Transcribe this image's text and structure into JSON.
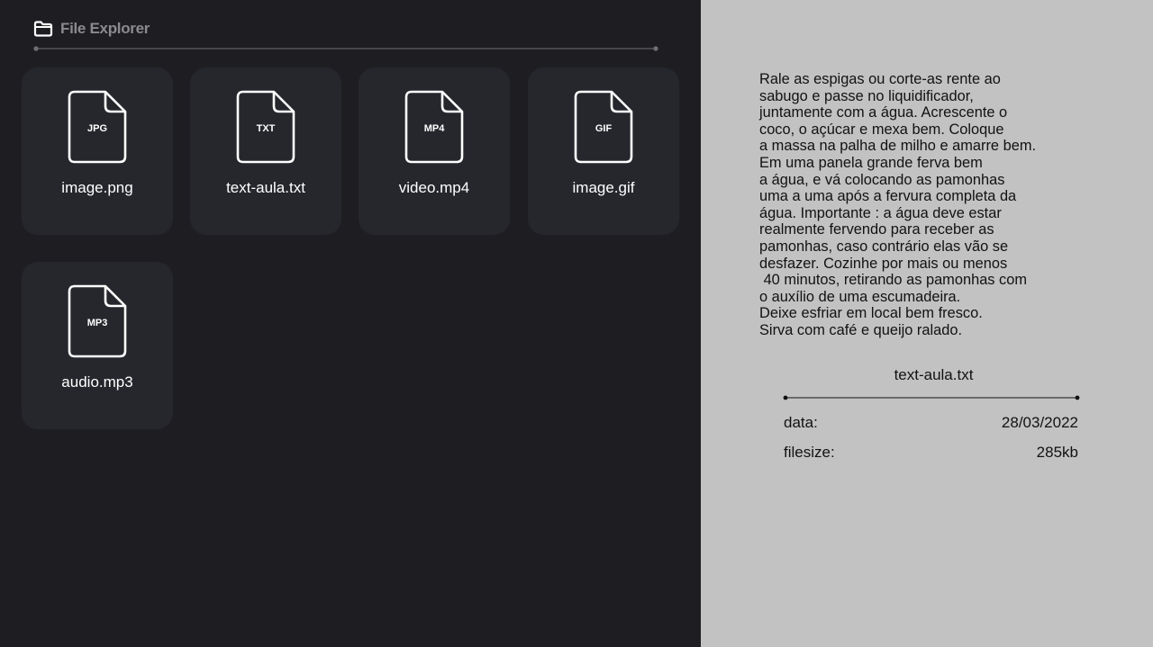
{
  "app": {
    "title": "File Explorer",
    "icon": "folder-icon"
  },
  "colors": {
    "panel_bg": "#1e1e22",
    "card_bg": "#26272d",
    "preview_bg": "#c2c2c2",
    "title_text": "#8b8b8f",
    "divider": "#6f6f74"
  },
  "files": [
    {
      "name": "image.png",
      "badge": "JPG",
      "icon": "file-icon"
    },
    {
      "name": "text-aula.txt",
      "badge": "TXT",
      "icon": "file-icon"
    },
    {
      "name": "video.mp4",
      "badge": "MP4",
      "icon": "file-icon"
    },
    {
      "name": "image.gif",
      "badge": "GIF",
      "icon": "file-icon"
    },
    {
      "name": "audio.mp3",
      "badge": "MP3",
      "icon": "file-icon"
    }
  ],
  "preview": {
    "content": "Rale as espigas ou corte-as rente ao\nsabugo e passe no liquidificador,\njuntamente com a água. Acrescente o\ncoco, o açúcar e mexa bem. Coloque\na massa na palha de milho e amarre bem.\nEm uma panela grande ferva bem\na água, e vá colocando as pamonhas\numa a uma após a fervura completa da\nágua. Importante : a água deve estar\nrealmente fervendo para receber as\npamonhas, caso contrário elas vão se\ndesfazer. Cozinhe por mais ou menos\n 40 minutos, retirando as pamonhas com\no auxílio de uma escumadeira.\nDeixe esfriar em local bem fresco.\nSirva com café e queijo ralado.",
    "filename": "text-aula.txt",
    "date_label": "data:",
    "date_value": "28/03/2022",
    "size_label": "filesize:",
    "size_value": "285kb"
  }
}
